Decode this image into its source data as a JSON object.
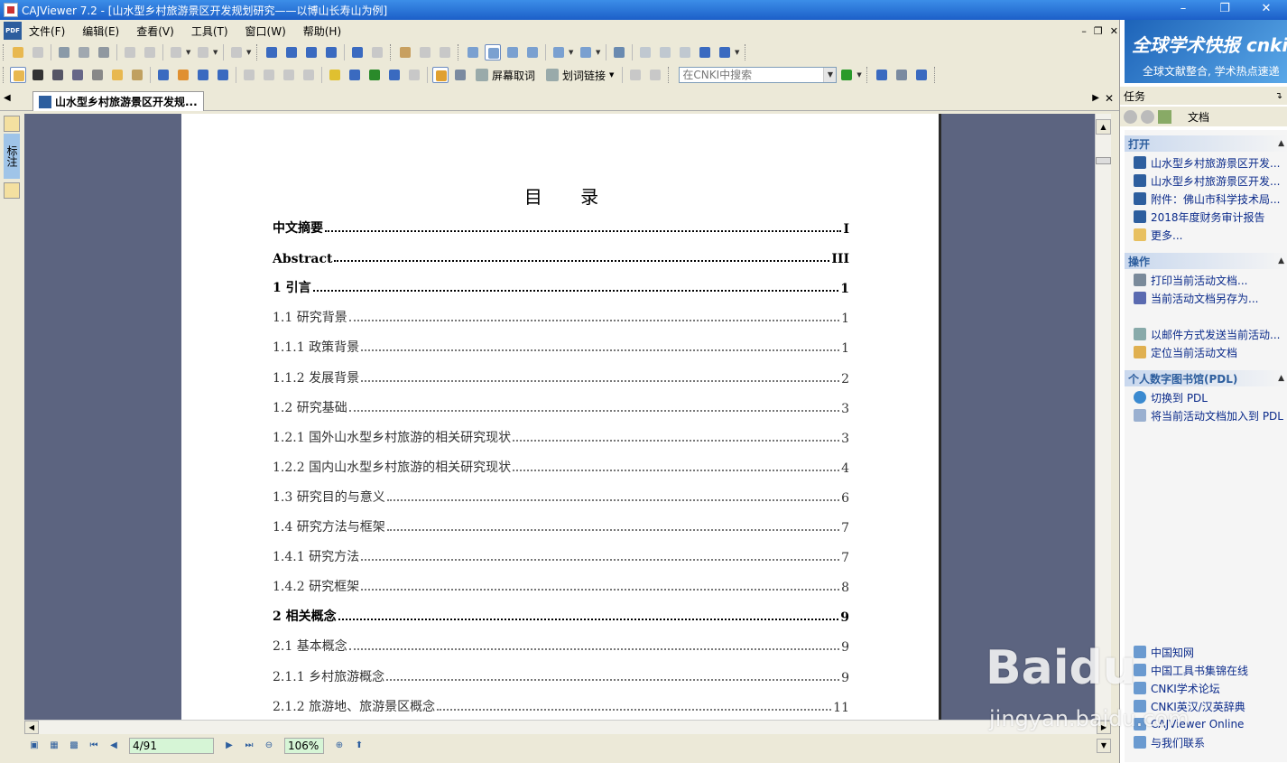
{
  "window": {
    "title": "CAJViewer 7.2 - [山水型乡村旅游景区开发规划研究——以博山长寿山为例]"
  },
  "menu": {
    "items": [
      "文件(F)",
      "编辑(E)",
      "查看(V)",
      "工具(T)",
      "窗口(W)",
      "帮助(H)"
    ]
  },
  "toolbar": {
    "screen_word_label": "屏幕取词",
    "word_link_label": "划词链接",
    "search_placeholder": "在CNKI中搜索"
  },
  "tab": {
    "label": "山水型乡村旅游景区开发规..."
  },
  "left_strip": {
    "annotation_label": "标注"
  },
  "document": {
    "toc_title": "目  录",
    "entries": [
      {
        "text": "中文摘要",
        "page": "I",
        "bold": true
      },
      {
        "text": "Abstract",
        "page": "III",
        "bold": true
      },
      {
        "text": "1 引言",
        "page": "1",
        "bold": true
      },
      {
        "text": "1.1 研究背景",
        "page": "1",
        "bold": false
      },
      {
        "text": "1.1.1 政策背景",
        "page": "1",
        "bold": false
      },
      {
        "text": "1.1.2 发展背景",
        "page": "2",
        "bold": false
      },
      {
        "text": "1.2 研究基础",
        "page": "3",
        "bold": false
      },
      {
        "text": "1.2.1 国外山水型乡村旅游的相关研究现状",
        "page": "3",
        "bold": false
      },
      {
        "text": "1.2.2 国内山水型乡村旅游的相关研究现状",
        "page": "4",
        "bold": false
      },
      {
        "text": "1.3 研究目的与意义",
        "page": "6",
        "bold": false
      },
      {
        "text": "1.4 研究方法与框架",
        "page": "7",
        "bold": false
      },
      {
        "text": "1.4.1 研究方法",
        "page": "7",
        "bold": false
      },
      {
        "text": "1.4.2 研究框架",
        "page": "8",
        "bold": false
      },
      {
        "text": "2  相关概念",
        "page": "9",
        "bold": true
      },
      {
        "text": "2.1 基本概念",
        "page": "9",
        "bold": false
      },
      {
        "text": "2.1.1 乡村旅游概念",
        "page": "9",
        "bold": false
      },
      {
        "text": "2.1.2 旅游地、旅游景区概念",
        "page": "11",
        "bold": false
      }
    ]
  },
  "status": {
    "page_indicator": "4/91",
    "zoom": "106%"
  },
  "right_panel": {
    "banner_title": "全球学术快报 cnki 移动版",
    "banner_subtitle": "全球文献整合, 学术热点速递",
    "header": "任务",
    "nav_label": "文档",
    "sections": {
      "open": {
        "title": "打开",
        "items": [
          "山水型乡村旅游景区开发...",
          "山水型乡村旅游景区开发...",
          "附件：佛山市科学技术局...",
          "2018年度财务审计报告",
          "更多..."
        ]
      },
      "actions": {
        "title": "操作",
        "items": [
          "打印当前活动文档...",
          "当前活动文档另存为...",
          "以邮件方式发送当前活动...",
          "定位当前活动文档"
        ]
      },
      "pdl": {
        "title": "个人数字图书馆(PDL)",
        "items": [
          "切换到 PDL",
          "将当前活动文档加入到 PDL"
        ]
      }
    },
    "links": [
      "中国知网",
      "中国工具书集锦在线",
      "CNKI学术论坛",
      "CNKI英汉/汉英辞典",
      "CAJViewer Online",
      "与我们联系"
    ]
  },
  "watermark": {
    "brand": "Baidu",
    "sub": "jingyan.baidu.com"
  },
  "colors": {
    "title_bar": "#1c5fc8",
    "doc_background": "#5c6480",
    "link_text": "#0a2a8a",
    "section_title": "#2d5e9e"
  }
}
